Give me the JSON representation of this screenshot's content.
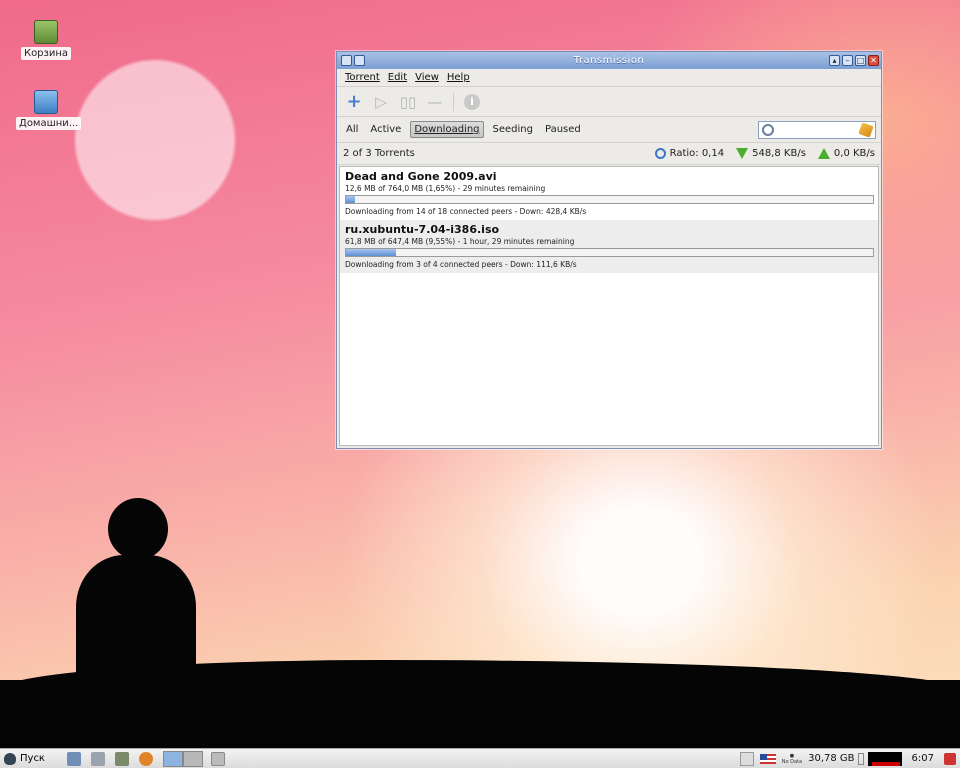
{
  "desktop": {
    "icons": [
      {
        "label": "Корзина",
        "icon": "trash-icon"
      },
      {
        "label": "Домашни...",
        "icon": "home-folder-icon"
      }
    ]
  },
  "window": {
    "title": "Transmission",
    "menu": [
      "Torrent",
      "Edit",
      "View",
      "Help"
    ],
    "toolbar_icons": [
      "add-icon",
      "start-icon",
      "pause-icon",
      "remove-icon",
      "info-icon"
    ],
    "filters": [
      "All",
      "Active",
      "Downloading",
      "Seeding",
      "Paused"
    ],
    "active_filter": "Downloading",
    "search": {
      "value": "",
      "placeholder": ""
    },
    "status": {
      "count": "2 of 3 Torrents",
      "ratio": "Ratio: 0,14",
      "down_speed": "548,8 KB/s",
      "up_speed": "0,0 KB/s"
    },
    "torrents": [
      {
        "name": "Dead and Gone 2009.avi",
        "progress_text": "12,6 MB of 764,0 MB (1,65%) - 29 minutes remaining",
        "progress_fraction": 0.0165,
        "status_text": "Downloading from 14 of 18 connected peers - Down: 428,4 KB/s"
      },
      {
        "name": "ru.xubuntu-7.04-i386.iso",
        "progress_text": "61,8 MB of 647,4 MB (9,55%) - 1 hour, 29 minutes remaining",
        "progress_fraction": 0.0955,
        "status_text": "Downloading from 3 of 4 connected peers - Down: 111,6 KB/s"
      }
    ]
  },
  "taskbar": {
    "start_label": "Пуск",
    "disk_free": "30,78 GB",
    "no_data_label": "No Data",
    "clock": "6:07"
  },
  "colors": {
    "titlebar": "#7d9ed3",
    "progress_fill": "#5f8fd4",
    "speed_arrow": "#4cae2f"
  }
}
